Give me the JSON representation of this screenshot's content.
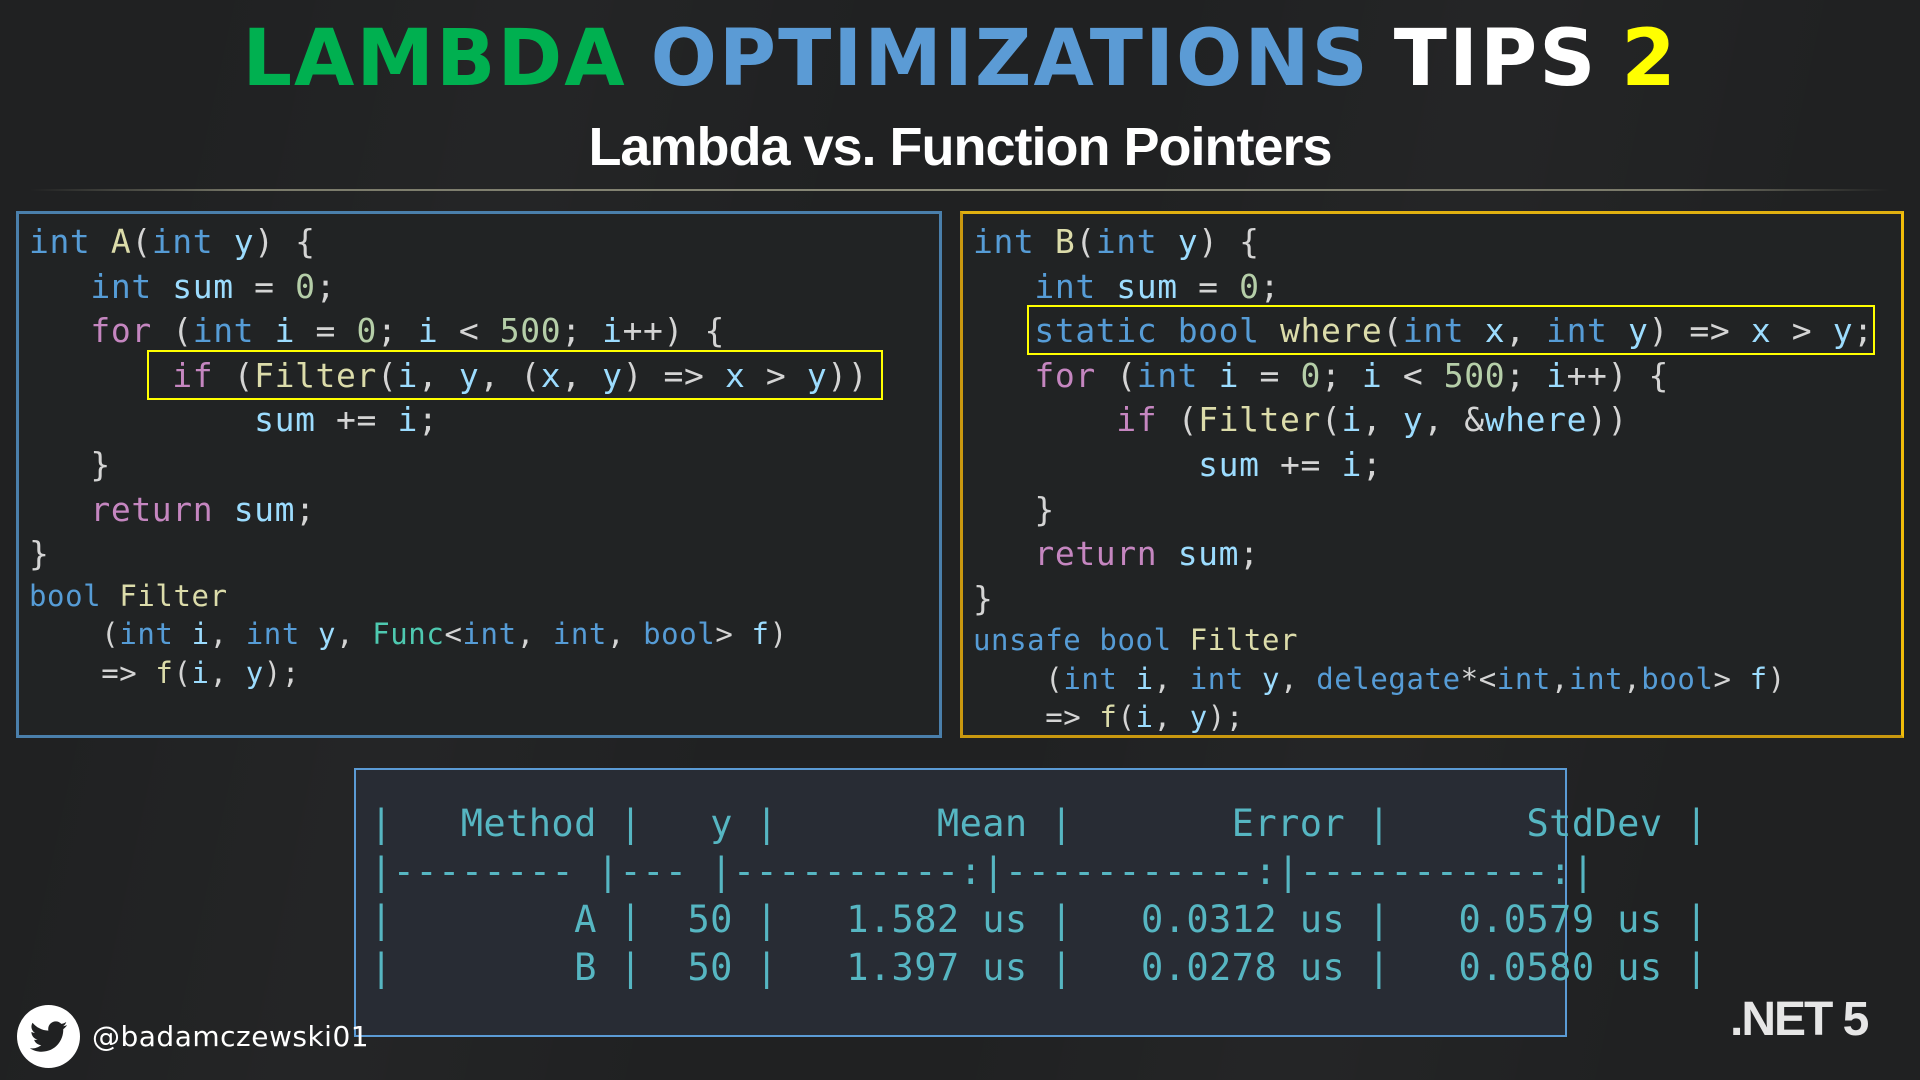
{
  "header": {
    "title_words": [
      {
        "text": "LAMBDA",
        "color": "#00b050"
      },
      {
        "text": "OPTIMIZATIONS",
        "color": "#5b9bd5"
      },
      {
        "text": "TIPS",
        "color": "#ffffff"
      },
      {
        "text": "2",
        "color": "#ffff00"
      }
    ],
    "subtitle": "Lambda vs. Function Pointers"
  },
  "code_a": {
    "border_color": "#4a7fab",
    "lines": [
      [
        [
          "kw",
          "int"
        ],
        [
          "pun",
          " "
        ],
        [
          "fn",
          "A"
        ],
        [
          "pun",
          "("
        ],
        [
          "kw",
          "int"
        ],
        [
          "pun",
          " "
        ],
        [
          "var",
          "y"
        ],
        [
          "pun",
          ") {"
        ]
      ],
      [
        [
          "pun",
          "   "
        ],
        [
          "kw",
          "int"
        ],
        [
          "pun",
          " "
        ],
        [
          "var",
          "sum"
        ],
        [
          "pun",
          " = "
        ],
        [
          "num",
          "0"
        ],
        [
          "pun",
          ";"
        ]
      ],
      [
        [
          "pun",
          "   "
        ],
        [
          "ctl",
          "for"
        ],
        [
          "pun",
          " ("
        ],
        [
          "kw",
          "int"
        ],
        [
          "pun",
          " "
        ],
        [
          "var",
          "i"
        ],
        [
          "pun",
          " = "
        ],
        [
          "num",
          "0"
        ],
        [
          "pun",
          "; "
        ],
        [
          "var",
          "i"
        ],
        [
          "pun",
          " < "
        ],
        [
          "num",
          "500"
        ],
        [
          "pun",
          "; "
        ],
        [
          "var",
          "i"
        ],
        [
          "pun",
          "++) {"
        ]
      ],
      [
        [
          "pun",
          "       "
        ],
        [
          "ctl",
          "if"
        ],
        [
          "pun",
          " ("
        ],
        [
          "fn",
          "Filter"
        ],
        [
          "pun",
          "("
        ],
        [
          "var",
          "i"
        ],
        [
          "pun",
          ", "
        ],
        [
          "var",
          "y"
        ],
        [
          "pun",
          ", ("
        ],
        [
          "var",
          "x"
        ],
        [
          "pun",
          ", "
        ],
        [
          "var",
          "y"
        ],
        [
          "pun",
          ") => "
        ],
        [
          "var",
          "x"
        ],
        [
          "pun",
          " > "
        ],
        [
          "var",
          "y"
        ],
        [
          "pun",
          "))"
        ]
      ],
      [
        [
          "pun",
          "           "
        ],
        [
          "var",
          "sum"
        ],
        [
          "pun",
          " += "
        ],
        [
          "var",
          "i"
        ],
        [
          "pun",
          ";"
        ]
      ],
      [
        [
          "pun",
          "   }"
        ]
      ],
      [
        [
          "pun",
          "   "
        ],
        [
          "ctl",
          "return"
        ],
        [
          "pun",
          " "
        ],
        [
          "var",
          "sum"
        ],
        [
          "pun",
          ";"
        ]
      ],
      [
        [
          "pun",
          "}"
        ]
      ]
    ],
    "small_lines": [
      [
        [
          "kw",
          "bool"
        ],
        [
          "pun",
          " "
        ],
        [
          "fn",
          "Filter"
        ]
      ],
      [
        [
          "pun",
          "    ("
        ],
        [
          "kw",
          "int"
        ],
        [
          "pun",
          " "
        ],
        [
          "var",
          "i"
        ],
        [
          "pun",
          ", "
        ],
        [
          "kw",
          "int"
        ],
        [
          "pun",
          " "
        ],
        [
          "var",
          "y"
        ],
        [
          "pun",
          ", "
        ],
        [
          "type",
          "Func"
        ],
        [
          "pun",
          "<"
        ],
        [
          "kw",
          "int"
        ],
        [
          "pun",
          ", "
        ],
        [
          "kw",
          "int"
        ],
        [
          "pun",
          ", "
        ],
        [
          "kw",
          "bool"
        ],
        [
          "pun",
          "> "
        ],
        [
          "var",
          "f"
        ],
        [
          "pun",
          ")"
        ]
      ],
      [
        [
          "pun",
          "    => "
        ],
        [
          "fn",
          "f"
        ],
        [
          "pun",
          "("
        ],
        [
          "var",
          "i"
        ],
        [
          "pun",
          ", "
        ],
        [
          "var",
          "y"
        ],
        [
          "pun",
          ");"
        ]
      ]
    ]
  },
  "code_b": {
    "border_color": "#e0b010",
    "lines": [
      [
        [
          "kw",
          "int"
        ],
        [
          "pun",
          " "
        ],
        [
          "fn",
          "B"
        ],
        [
          "pun",
          "("
        ],
        [
          "kw",
          "int"
        ],
        [
          "pun",
          " "
        ],
        [
          "var",
          "y"
        ],
        [
          "pun",
          ") {"
        ]
      ],
      [
        [
          "pun",
          "   "
        ],
        [
          "kw",
          "int"
        ],
        [
          "pun",
          " "
        ],
        [
          "var",
          "sum"
        ],
        [
          "pun",
          " = "
        ],
        [
          "num",
          "0"
        ],
        [
          "pun",
          ";"
        ]
      ],
      [
        [
          "pun",
          "   "
        ],
        [
          "kw",
          "static"
        ],
        [
          "pun",
          " "
        ],
        [
          "kw",
          "bool"
        ],
        [
          "pun",
          " "
        ],
        [
          "fn",
          "where"
        ],
        [
          "pun",
          "("
        ],
        [
          "kw",
          "int"
        ],
        [
          "pun",
          " "
        ],
        [
          "var",
          "x"
        ],
        [
          "pun",
          ", "
        ],
        [
          "kw",
          "int"
        ],
        [
          "pun",
          " "
        ],
        [
          "var",
          "y"
        ],
        [
          "pun",
          ") => "
        ],
        [
          "var",
          "x"
        ],
        [
          "pun",
          " > "
        ],
        [
          "var",
          "y"
        ],
        [
          "pun",
          ";"
        ]
      ],
      [
        [
          "pun",
          "   "
        ],
        [
          "ctl",
          "for"
        ],
        [
          "pun",
          " ("
        ],
        [
          "kw",
          "int"
        ],
        [
          "pun",
          " "
        ],
        [
          "var",
          "i"
        ],
        [
          "pun",
          " = "
        ],
        [
          "num",
          "0"
        ],
        [
          "pun",
          "; "
        ],
        [
          "var",
          "i"
        ],
        [
          "pun",
          " < "
        ],
        [
          "num",
          "500"
        ],
        [
          "pun",
          "; "
        ],
        [
          "var",
          "i"
        ],
        [
          "pun",
          "++) {"
        ]
      ],
      [
        [
          "pun",
          "       "
        ],
        [
          "ctl",
          "if"
        ],
        [
          "pun",
          " ("
        ],
        [
          "fn",
          "Filter"
        ],
        [
          "pun",
          "("
        ],
        [
          "var",
          "i"
        ],
        [
          "pun",
          ", "
        ],
        [
          "var",
          "y"
        ],
        [
          "pun",
          ", &"
        ],
        [
          "var",
          "where"
        ],
        [
          "pun",
          "))"
        ]
      ],
      [
        [
          "pun",
          "           "
        ],
        [
          "var",
          "sum"
        ],
        [
          "pun",
          " += "
        ],
        [
          "var",
          "i"
        ],
        [
          "pun",
          ";"
        ]
      ],
      [
        [
          "pun",
          "   }"
        ]
      ],
      [
        [
          "pun",
          "   "
        ],
        [
          "ctl",
          "return"
        ],
        [
          "pun",
          " "
        ],
        [
          "var",
          "sum"
        ],
        [
          "pun",
          ";"
        ]
      ],
      [
        [
          "pun",
          "}"
        ]
      ]
    ],
    "small_lines": [
      [
        [
          "kw",
          "unsafe"
        ],
        [
          "pun",
          " "
        ],
        [
          "kw",
          "bool"
        ],
        [
          "pun",
          " "
        ],
        [
          "fn",
          "Filter"
        ]
      ],
      [
        [
          "pun",
          "    ("
        ],
        [
          "kw",
          "int"
        ],
        [
          "pun",
          " "
        ],
        [
          "var",
          "i"
        ],
        [
          "pun",
          ", "
        ],
        [
          "kw",
          "int"
        ],
        [
          "pun",
          " "
        ],
        [
          "var",
          "y"
        ],
        [
          "pun",
          ", "
        ],
        [
          "kw",
          "delegate"
        ],
        [
          "pun",
          "*<"
        ],
        [
          "kw",
          "int"
        ],
        [
          "pun",
          ","
        ],
        [
          "kw",
          "int"
        ],
        [
          "pun",
          ","
        ],
        [
          "kw",
          "bool"
        ],
        [
          "pun",
          "> "
        ],
        [
          "var",
          "f"
        ],
        [
          "pun",
          ")"
        ]
      ],
      [
        [
          "pun",
          "    => "
        ],
        [
          "fn",
          "f"
        ],
        [
          "pun",
          "("
        ],
        [
          "var",
          "i"
        ],
        [
          "pun",
          ", "
        ],
        [
          "var",
          "y"
        ],
        [
          "pun",
          ");"
        ]
      ]
    ]
  },
  "benchmark": {
    "columns": [
      "Method",
      "y",
      "Mean",
      "Error",
      "StdDev"
    ],
    "separator": "|-------- |--- |----------:|-----------:|-----------:|",
    "rows": [
      {
        "method": "A",
        "y": "50",
        "mean": "1.582 us",
        "error": "0.0312 us",
        "stddev": "0.0579 us"
      },
      {
        "method": "B",
        "y": "50",
        "mean": "1.397 us",
        "error": "0.0278 us",
        "stddev": "0.0580 us"
      }
    ],
    "text_color": "#56b6c2"
  },
  "footer": {
    "twitter_icon": "twitter-bird-icon",
    "handle": "@badamczewski01",
    "platform": ".NET 5"
  }
}
